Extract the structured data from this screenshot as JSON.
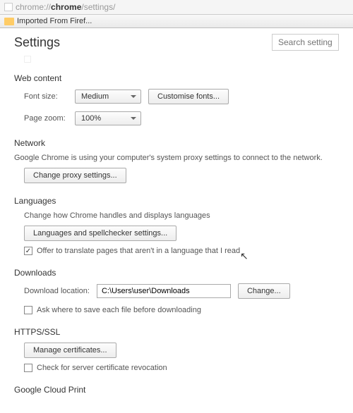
{
  "url": {
    "prefix": "chrome://",
    "bold": "chrome",
    "suffix": "/settings/"
  },
  "bookmark": {
    "label": "Imported From Firef..."
  },
  "page": {
    "title": "Settings",
    "search_placeholder": "Search settings"
  },
  "web_content": {
    "heading": "Web content",
    "font_label": "Font size:",
    "font_value": "Medium",
    "customise_btn": "Customise fonts...",
    "zoom_label": "Page zoom:",
    "zoom_value": "100%"
  },
  "network": {
    "heading": "Network",
    "desc": "Google Chrome is using your computer's system proxy settings to connect to the network.",
    "btn": "Change proxy settings..."
  },
  "languages": {
    "heading": "Languages",
    "desc": "Change how Chrome handles and displays languages",
    "btn": "Languages and spellchecker settings...",
    "translate_check": "Offer to translate pages that aren't in a language that I read"
  },
  "downloads": {
    "heading": "Downloads",
    "label": "Download location:",
    "value": "C:\\Users\\user\\Downloads",
    "btn": "Change...",
    "ask_check": "Ask where to save each file before downloading"
  },
  "https": {
    "heading": "HTTPS/SSL",
    "btn": "Manage certificates...",
    "revoke_check": "Check for server certificate revocation"
  },
  "cloud": {
    "heading": "Google Cloud Print"
  }
}
